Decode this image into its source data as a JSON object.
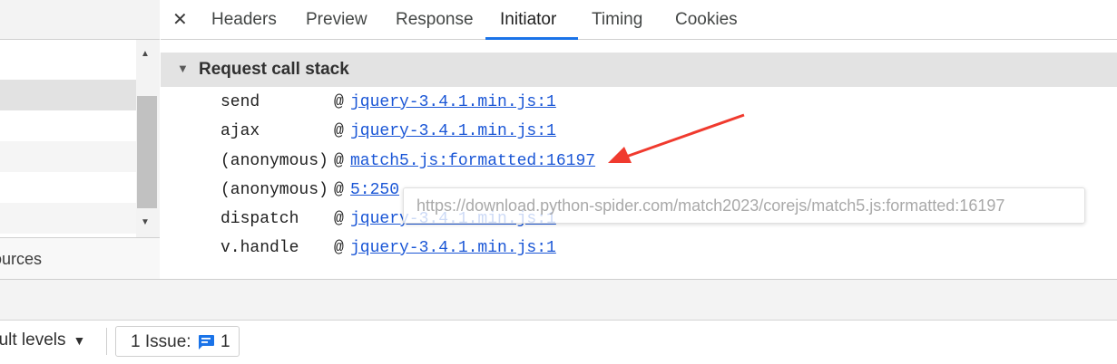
{
  "tabs": {
    "close_glyph": "✕",
    "items": [
      "Headers",
      "Preview",
      "Response",
      "Initiator",
      "Timing",
      "Cookies"
    ],
    "active": "Initiator"
  },
  "section": {
    "arrow_glyph": "▼",
    "title": "Request call stack"
  },
  "call_stack": [
    {
      "fn": "send",
      "at": "@",
      "link": "jquery-3.4.1.min.js:1"
    },
    {
      "fn": "ajax",
      "at": "@",
      "link": "jquery-3.4.1.min.js:1"
    },
    {
      "fn": "(anonymous)",
      "at": "@",
      "link": "match5.js:formatted:16197"
    },
    {
      "fn": "(anonymous)",
      "at": "@",
      "link": "5:250"
    },
    {
      "fn": "dispatch",
      "at": "@",
      "link": "jquery-3.4.1.min.js:1"
    },
    {
      "fn": "v.handle",
      "at": "@",
      "link": "jquery-3.4.1.min.js:1"
    }
  ],
  "tooltip": {
    "url": "https://download.python-spider.com/match2023/corejs/match5.js:formatted:16197"
  },
  "left_panel": {
    "sources_label": "ources",
    "scroll_up_glyph": "▲",
    "scroll_down_glyph": "▼"
  },
  "bottom": {
    "levels_label": "ault levels",
    "levels_caret": "▼",
    "issue_label": "1 Issue:",
    "issue_count": "1"
  },
  "colors": {
    "accent": "#1a73e8",
    "link": "#1a56d6",
    "annotation_arrow": "#f03a2e"
  }
}
